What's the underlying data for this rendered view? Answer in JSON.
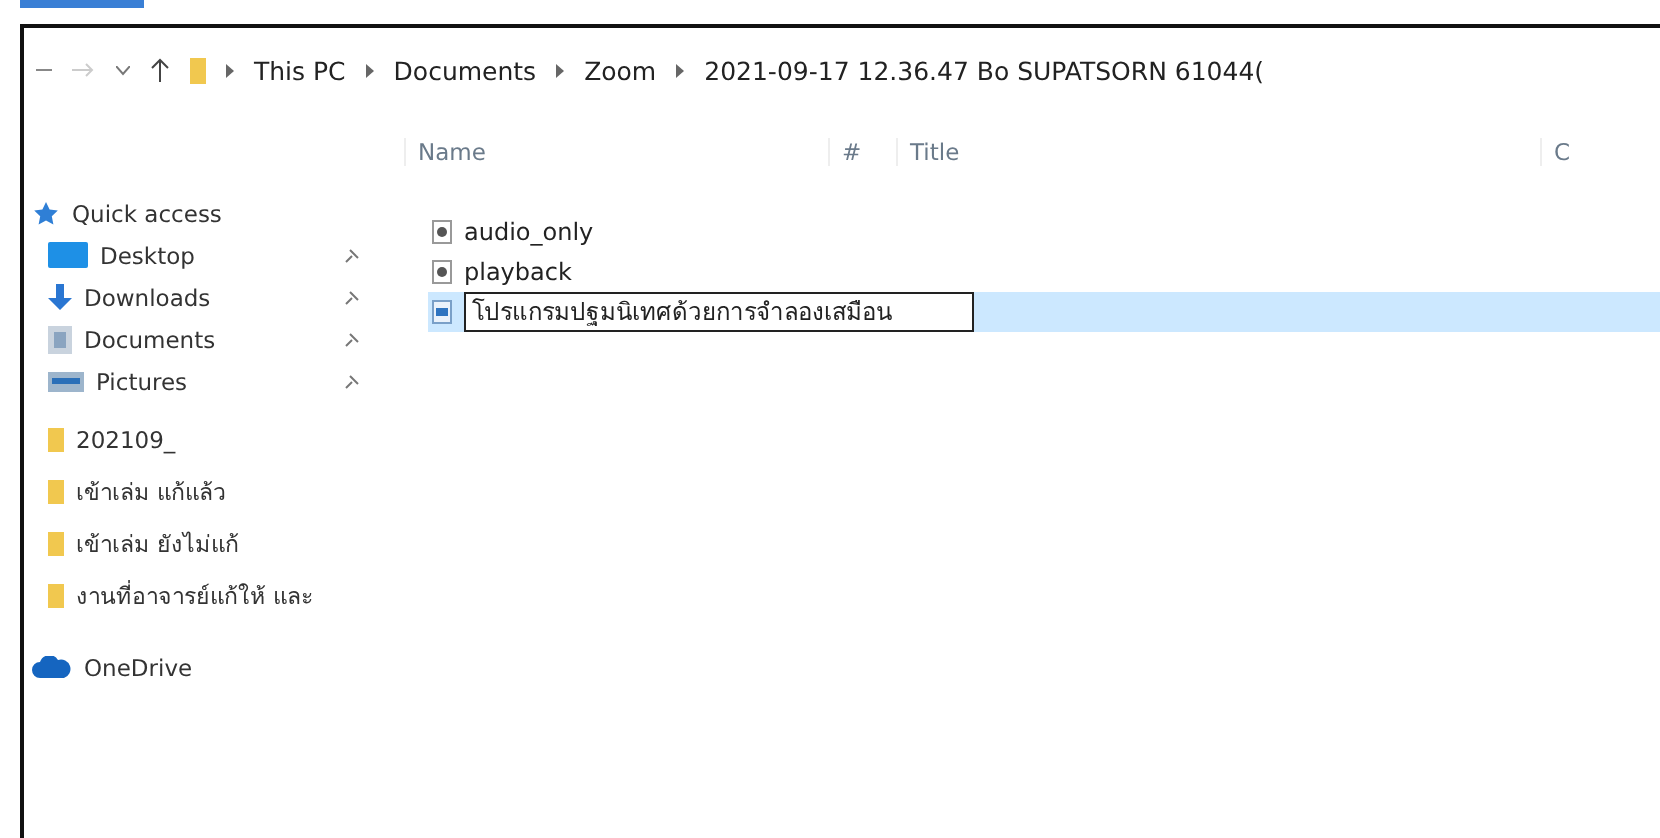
{
  "breadcrumb": [
    "This PC",
    "Documents",
    "Zoom",
    "2021-09-17 12.36.47 Bo SUPATSORN 61044("
  ],
  "sidebar": {
    "items": [
      {
        "label": "Quick access",
        "kind": "quick",
        "pinned": false
      },
      {
        "label": "Desktop",
        "kind": "desktop",
        "pinned": true
      },
      {
        "label": "Downloads",
        "kind": "downloads",
        "pinned": true
      },
      {
        "label": "Documents",
        "kind": "documents",
        "pinned": true
      },
      {
        "label": "Pictures",
        "kind": "pictures",
        "pinned": true
      },
      {
        "label": "202109_",
        "kind": "folder",
        "pinned": false
      },
      {
        "label": "เข้าเล่ม แก้แล้ว",
        "kind": "folder",
        "pinned": false
      },
      {
        "label": "เข้าเล่ม ยังไม่แก้",
        "kind": "folder",
        "pinned": false
      },
      {
        "label": "งานที่อาจารย์แก้ให้ และ",
        "kind": "folder",
        "pinned": false
      },
      {
        "label": "OneDrive",
        "kind": "cloud",
        "pinned": false
      }
    ]
  },
  "columns": [
    "Name",
    "#",
    "Title",
    "C"
  ],
  "files": [
    {
      "name": "audio_only",
      "kind": "audio",
      "selected": false,
      "renaming": false
    },
    {
      "name": "playback",
      "kind": "audio",
      "selected": false,
      "renaming": false
    },
    {
      "name": "โปรแกรมปฐมนิเทศด้วยการจำลองเสมือน",
      "kind": "video",
      "selected": true,
      "renaming": true
    }
  ]
}
